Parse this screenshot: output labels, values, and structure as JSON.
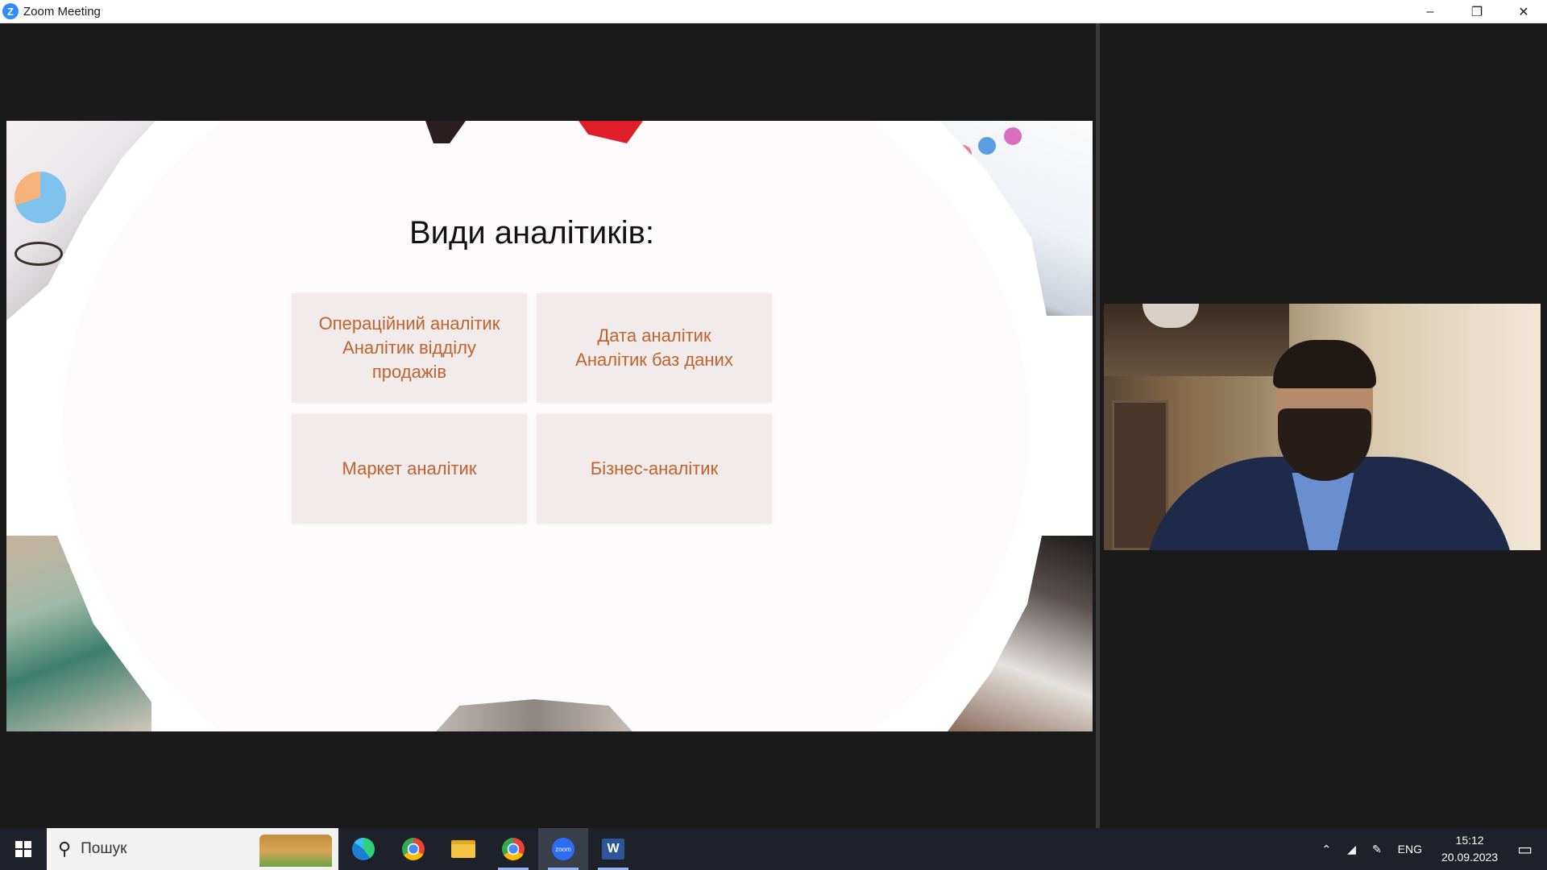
{
  "window": {
    "title": "Zoom Meeting",
    "controls": {
      "minimize": "–",
      "restore": "❐",
      "close": "✕"
    }
  },
  "slide": {
    "title": "Види аналітиків:",
    "cards": [
      "Операційний аналітик\nАналітик відділу\nпродажів",
      "Дата аналітик\nАналітик баз даних",
      "Маркет аналітик",
      "Бізнес-аналітик"
    ],
    "accent_color": "#c0622a"
  },
  "taskbar": {
    "search_placeholder": "Пошук",
    "apps": [
      "edge-icon",
      "chrome-icon",
      "file-explorer-icon",
      "chrome-profile-icon",
      "zoom-icon",
      "word-icon"
    ],
    "active_app": "zoom-icon",
    "zoom_label": "zoom",
    "word_label": "W",
    "tray": {
      "language": "ENG",
      "time": "15:12",
      "date": "20.09.2023"
    }
  }
}
